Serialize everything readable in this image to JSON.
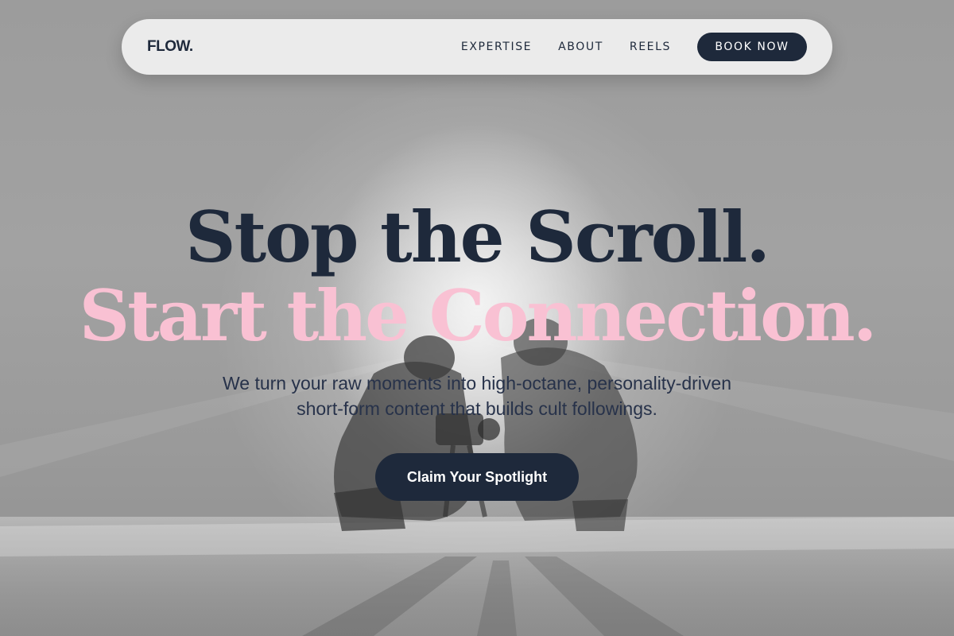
{
  "nav": {
    "logo": "FLOW.",
    "links": [
      {
        "label": "EXPERTISE"
      },
      {
        "label": "ABOUT"
      },
      {
        "label": "REELS"
      }
    ],
    "cta_label": "BOOK NOW"
  },
  "hero": {
    "headline_line1": "Stop the Scroll.",
    "headline_line2": "Start the Connection.",
    "subtext": "We turn your raw moments into high-octane, personality-driven short-form content that builds cult followings.",
    "cta_label": "Claim Your Spotlight",
    "background_image": "grayscale-photo-of-two-filmmakers-crouching-with-camera-backlit"
  },
  "colors": {
    "navy": "#1e293b",
    "pink": "#f9c1d3",
    "navbar_bg": "#ebebeb",
    "background_gray": "#9a9a9a"
  }
}
